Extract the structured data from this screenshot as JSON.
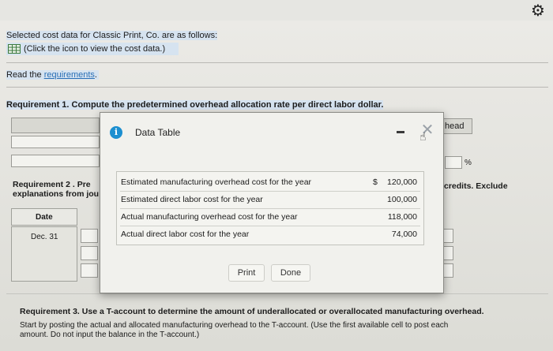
{
  "intro": {
    "line1": "Selected cost data for Classic Print, Co. are as follows:",
    "view_link": "(Click the icon to view the cost data.)",
    "read_prefix": "Read the ",
    "read_link": "requirements",
    "read_suffix": "."
  },
  "requirement1": {
    "title": "Requirement 1. Compute the predetermined overhead allocation rate per direct labor dollar.",
    "right_label": "head",
    "percent": "%"
  },
  "requirement2": {
    "title_part": "Requirement 2 . Pre",
    "explanation_part": "explanations from jou",
    "right_text": "credits. Exclude",
    "date_header": "Date",
    "date_row": "Dec. 31"
  },
  "requirement3": {
    "title": "Requirement 3. Use a T-account to determine the amount of underallocated or overallocated manufacturing overhead.",
    "line2": "Start by posting the actual and allocated manufacturing overhead to the T-account. (Use the first available cell to post each",
    "line3": "amount. Do not input the balance in the T-account.)"
  },
  "modal": {
    "title": "Data Table",
    "icon": "info-icon",
    "close_glyph": "✕",
    "rows": [
      {
        "label": "Estimated manufacturing overhead cost for the year",
        "currency": "$",
        "value": "120,000"
      },
      {
        "label": "Estimated direct labor cost for the year",
        "currency": "",
        "value": "100,000"
      },
      {
        "label": "Actual manufacturing overhead cost for the year",
        "currency": "",
        "value": "118,000"
      },
      {
        "label": "Actual direct labor cost for the year",
        "currency": "",
        "value": "74,000"
      }
    ],
    "print_label": "Print",
    "done_label": "Done"
  },
  "icons": {
    "gear": "gear-icon",
    "grid": "table-grid-icon"
  }
}
